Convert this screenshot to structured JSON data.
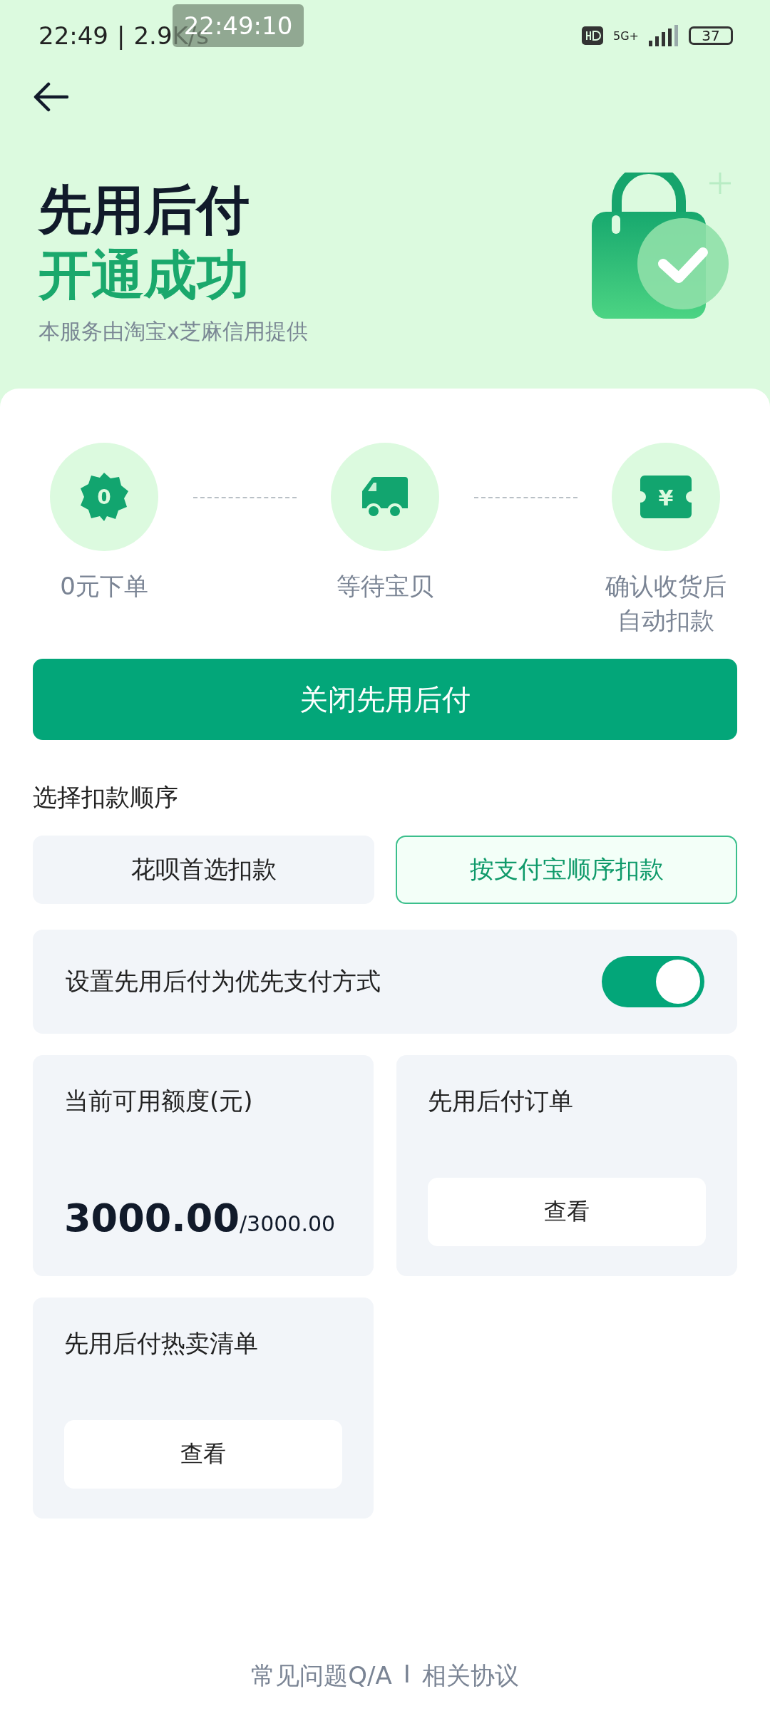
{
  "status_bar": {
    "time": "22:49",
    "divider": "|",
    "speed": "2.9K/s",
    "network": "5G+",
    "battery": "37",
    "recorder_time": "22:49:10"
  },
  "header": {
    "title": "先用后付",
    "subtitle": "开通成功",
    "provider": "本服务由淘宝x芝麻信用提供"
  },
  "steps": [
    {
      "kind": "badge",
      "badge_text": "0",
      "label": "0元下单"
    },
    {
      "kind": "truck",
      "label": "等待宝贝"
    },
    {
      "kind": "ticket",
      "badge_text": "¥",
      "label": "确认收货后自动扣款"
    }
  ],
  "close_button": "关闭先用后付",
  "order_section": {
    "title": "选择扣款顺序",
    "options": [
      {
        "label": "花呗首选扣款",
        "selected": false
      },
      {
        "label": "按支付宝顺序扣款",
        "selected": true
      }
    ]
  },
  "priority_setting": {
    "label": "设置先用后付为优先支付方式",
    "on": true
  },
  "credit_card": {
    "title": "当前可用额度(元)",
    "available": "3000.00",
    "total": "/3000.00"
  },
  "orders_card": {
    "title": "先用后付订单",
    "button": "查看"
  },
  "hot_list_card": {
    "title": "先用后付热卖清单",
    "button": "查看"
  },
  "footer": {
    "faq_link": "常见问题Q/A",
    "separator": "I",
    "agreement_link": "相关协议"
  }
}
